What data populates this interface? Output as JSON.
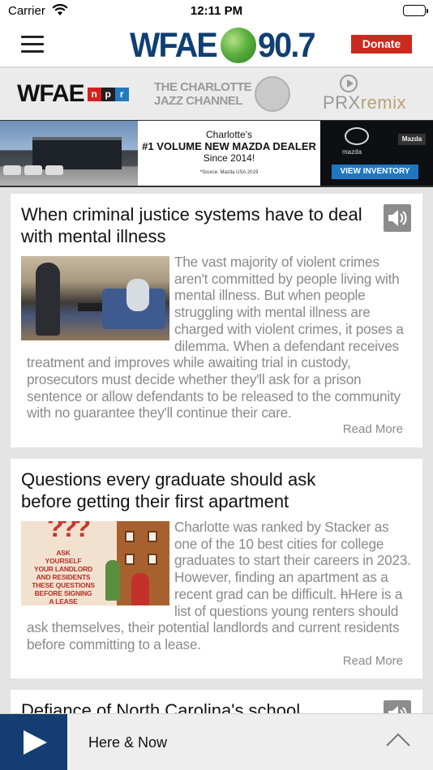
{
  "status_bar": {
    "carrier": "Carrier",
    "time": "12:11 PM"
  },
  "header": {
    "logo_left": "WFAE",
    "logo_right": "90.7",
    "donate_label": "Donate"
  },
  "stations": [
    {
      "name": "WFAE",
      "npr": [
        "n",
        "p",
        "r"
      ]
    },
    {
      "line1": "THE CHARLOTTE",
      "line2": "JAZZ CHANNEL"
    },
    {
      "prefix": "PRX",
      "suffix": "remix"
    }
  ],
  "ad": {
    "line1": "Charlotte's",
    "line2": "#1 VOLUME NEW MAZDA DEALER",
    "line3": "Since 2014!",
    "source": "*Source: Mazda USA 2019",
    "brand": "mazda",
    "badge": "Mazda",
    "cta": "VIEW INVENTORY"
  },
  "stories": [
    {
      "title": "When criminal justice systems have to deal with mental illness",
      "body": "The vast majority of violent crimes aren't committed by people living with mental illness. But when people struggling with mental illness are charged with violent crimes, it poses a dilemma. When a defendant receives treatment and improves while awaiting trial in custody, prosecutors must decide whether they'll ask for a prison sentence or allow defendants to be released to the community with no guarantee they'll continue their care.",
      "read_more": "Read More"
    },
    {
      "title": "Questions every graduate should ask before getting their first apartment",
      "body_before": "Charlotte was ranked by Stacker as one of the 10 best cities for college graduates to start their careers in 2023. However, finding an apartment as a recent grad can be difficult. ",
      "struck": "h",
      "body_after": "Here is a list of questions young renters should ask themselves, their potential landlords and current residents before committing to a lease.",
      "image_text": [
        "ASK",
        "YOURSELF",
        "YOUR LANDLORD",
        "AND RESIDENTS",
        "THESE QUESTIONS",
        "BEFORE SIGNING",
        "A LEASE"
      ],
      "read_more": "Read More"
    },
    {
      "title": "Defiance of North Carolina's school"
    }
  ],
  "player": {
    "now_playing": "Here & Now"
  }
}
